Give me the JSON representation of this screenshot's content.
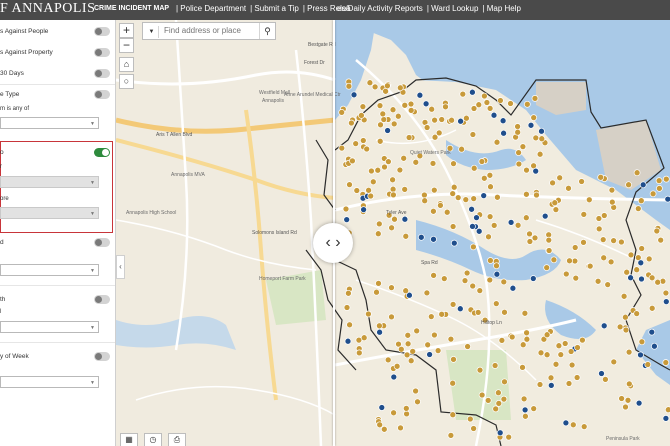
{
  "header": {
    "brand": "F ANNAPOLIS",
    "app_title": "CRIME INCIDENT MAP",
    "links": [
      {
        "label": "| Police Department"
      },
      {
        "label": "| Submit a Tip"
      },
      {
        "label": "| Press Relea"
      },
      {
        "label": "es/Daily Activity Reports"
      },
      {
        "label": "| Ward Lookup"
      },
      {
        "label": "| Map Help"
      }
    ]
  },
  "filters": {
    "crimes_people": {
      "label": "s Against People",
      "on": false
    },
    "crimes_property": {
      "label": "s Against Property",
      "on": false
    },
    "last_days": {
      "label": "30 Days",
      "on": false
    },
    "crime_type": {
      "label": "e Type",
      "on": false,
      "sub_label": "m is any of"
    },
    "date_filter": {
      "label": "o",
      "on": true,
      "after_label": "r",
      "before_label": "ore"
    },
    "ward": {
      "label": "d",
      "on": false
    },
    "month": {
      "label": "th",
      "on": false,
      "sub_label": "l"
    },
    "day_of_week": {
      "label": "y of Week",
      "on": false
    }
  },
  "map": {
    "search_placeholder": "Find address or place",
    "zoom_in": "+",
    "zoom_out": "−",
    "labels": [
      {
        "text": "Westfield Mall",
        "cls": ""
      },
      {
        "text": "Annapolis",
        "cls": ""
      },
      {
        "text": "Anne Arundel Medical Ctr",
        "cls": ""
      },
      {
        "text": "Forest Dr",
        "cls": "road"
      },
      {
        "text": "Annapolis High School",
        "cls": ""
      },
      {
        "text": "Annapolis MVA",
        "cls": ""
      },
      {
        "text": "Aris T Allen Blvd",
        "cls": "road"
      },
      {
        "text": "Homeport Farm Park",
        "cls": ""
      },
      {
        "text": "Bestgate Rd",
        "cls": "road"
      },
      {
        "text": "Quiet Waters Park",
        "cls": ""
      },
      {
        "text": "Peninsula Park",
        "cls": ""
      },
      {
        "text": "Hilltop Ln",
        "cls": "road"
      },
      {
        "text": "Tyler Ave",
        "cls": "road"
      },
      {
        "text": "Spa Rd",
        "cls": "road"
      },
      {
        "text": "Solomons Island Rd",
        "cls": "road"
      }
    ]
  },
  "colors": {
    "topbar": "#4a4a4a",
    "toggle_on": "#2e8b3d",
    "highlight": "#c8353a",
    "incident": "#c89a3a",
    "incident_alt": "#1f4e8c",
    "water": "#a9c9e7"
  }
}
